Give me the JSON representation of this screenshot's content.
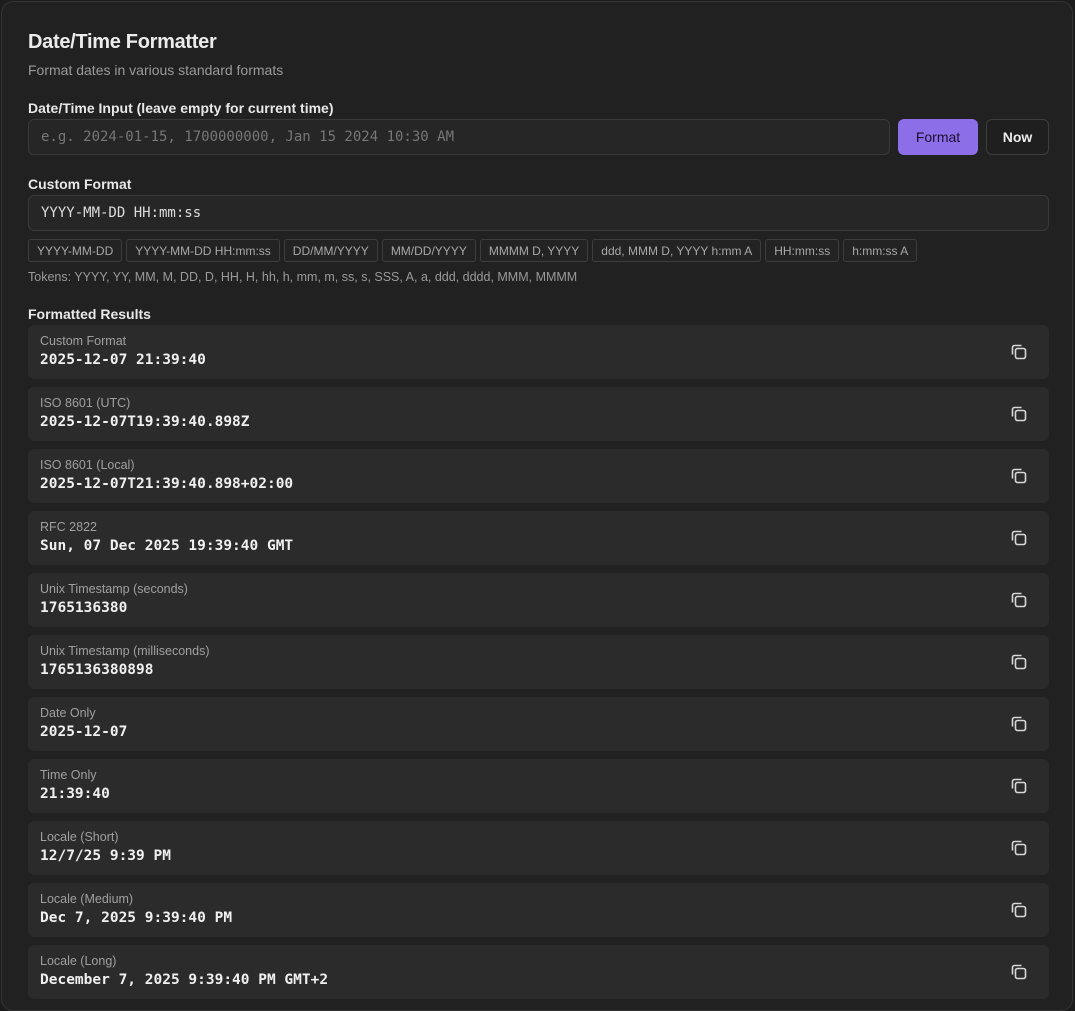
{
  "header": {
    "title": "Date/Time Formatter",
    "subtitle": "Format dates in various standard formats"
  },
  "input": {
    "label": "Date/Time Input (leave empty for current time)",
    "placeholder": "e.g. 2024-01-15, 1700000000, Jan 15 2024 10:30 AM",
    "value": "",
    "format_button": "Format",
    "now_button": "Now"
  },
  "custom_format": {
    "label": "Custom Format",
    "value": "YYYY-MM-DD HH:mm:ss",
    "presets": [
      "YYYY-MM-DD",
      "YYYY-MM-DD HH:mm:ss",
      "DD/MM/YYYY",
      "MM/DD/YYYY",
      "MMMM D, YYYY",
      "ddd, MMM D, YYYY h:mm A",
      "HH:mm:ss",
      "h:mm:ss A"
    ],
    "tokens": "Tokens: YYYY, YY, MM, M, DD, D, HH, H, hh, h, mm, m, ss, s, SSS, A, a, ddd, dddd, MMM, MMMM"
  },
  "results": {
    "label": "Formatted Results",
    "items": [
      {
        "label": "Custom Format",
        "value": "2025-12-07 21:39:40"
      },
      {
        "label": "ISO 8601 (UTC)",
        "value": "2025-12-07T19:39:40.898Z"
      },
      {
        "label": "ISO 8601 (Local)",
        "value": "2025-12-07T21:39:40.898+02:00"
      },
      {
        "label": "RFC 2822",
        "value": "Sun, 07 Dec 2025 19:39:40 GMT"
      },
      {
        "label": "Unix Timestamp (seconds)",
        "value": "1765136380"
      },
      {
        "label": "Unix Timestamp (milliseconds)",
        "value": "1765136380898"
      },
      {
        "label": "Date Only",
        "value": "2025-12-07"
      },
      {
        "label": "Time Only",
        "value": "21:39:40"
      },
      {
        "label": "Locale (Short)",
        "value": "12/7/25 9:39 PM"
      },
      {
        "label": "Locale (Medium)",
        "value": "Dec 7, 2025 9:39:40 PM"
      },
      {
        "label": "Locale (Long)",
        "value": "December 7, 2025 9:39:40 PM GMT+2"
      }
    ]
  },
  "icons": {
    "copy": "copy-icon"
  },
  "colors": {
    "accent": "#8b6ee8",
    "background": "#212121",
    "row": "#2b2b2b"
  }
}
